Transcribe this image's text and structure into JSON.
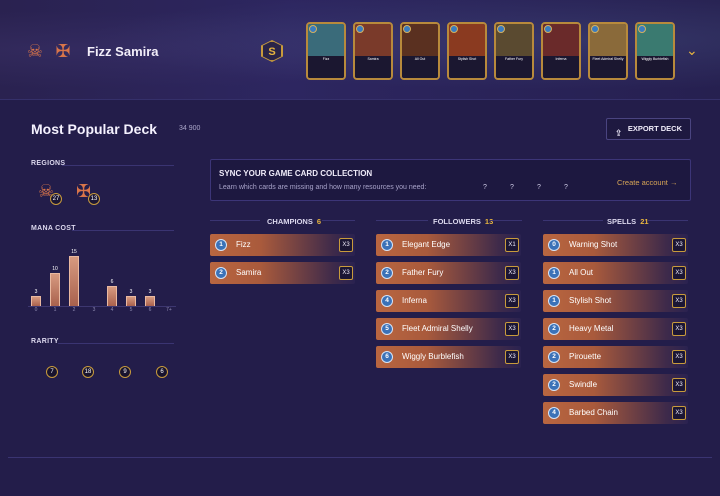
{
  "header": {
    "deck_title": "Fizz Samira",
    "tier": "S",
    "region_icons": [
      "bilgewater-icon",
      "noxus-icon"
    ],
    "cards": [
      {
        "name": "Fizz",
        "color": "#3a6b7a"
      },
      {
        "name": "Samira",
        "color": "#7a3a2a"
      },
      {
        "name": "All Out",
        "color": "#5a3020"
      },
      {
        "name": "Stylish Shot",
        "color": "#8a3a20"
      },
      {
        "name": "Father Fury",
        "color": "#5a4a30"
      },
      {
        "name": "Inferna",
        "color": "#6a2a2a"
      },
      {
        "name": "Fleet Admiral Shelly",
        "color": "#8a6a3a"
      },
      {
        "name": "Wiggly Burblefish",
        "color": "#3a7a70"
      }
    ]
  },
  "deck": {
    "title": "Most Popular Deck",
    "count": "34 900",
    "export_label": "EXPORT DECK"
  },
  "regions": {
    "label": "REGIONS",
    "items": [
      {
        "icon": "bilgewater-icon",
        "count": "27"
      },
      {
        "icon": "noxus-icon",
        "count": "13"
      }
    ]
  },
  "mana_cost": {
    "label": "MANA COST",
    "chart_data": {
      "type": "bar",
      "categories": [
        "0",
        "1",
        "2",
        "3",
        "4",
        "5",
        "6",
        "7+"
      ],
      "values": [
        3,
        10,
        15,
        0,
        6,
        3,
        3,
        0
      ]
    }
  },
  "rarity": {
    "label": "RARITY",
    "values": [
      "7",
      "18",
      "9",
      "6"
    ]
  },
  "sync": {
    "title": "SYNC YOUR GAME CARD COLLECTION",
    "subtitle": "Learn which cards are missing and how many resources you need:",
    "unknowns": [
      "?",
      "?",
      "?",
      "?"
    ],
    "link": "Create account →"
  },
  "columns": {
    "champions": {
      "label": "CHAMPIONS",
      "count": "6",
      "cards": [
        {
          "mana": "1",
          "name": "Fizz",
          "qty": "X3"
        },
        {
          "mana": "2",
          "name": "Samira",
          "qty": "X3"
        }
      ]
    },
    "followers": {
      "label": "FOLLOWERS",
      "count": "13",
      "cards": [
        {
          "mana": "1",
          "name": "Elegant Edge",
          "qty": "X1"
        },
        {
          "mana": "2",
          "name": "Father Fury",
          "qty": "X3"
        },
        {
          "mana": "4",
          "name": "Inferna",
          "qty": "X3"
        },
        {
          "mana": "5",
          "name": "Fleet Admiral Shelly",
          "qty": "X3"
        },
        {
          "mana": "6",
          "name": "Wiggly Burblefish",
          "qty": "X3"
        }
      ]
    },
    "spells": {
      "label": "SPELLS",
      "count": "21",
      "cards": [
        {
          "mana": "0",
          "name": "Warning Shot",
          "qty": "X3"
        },
        {
          "mana": "1",
          "name": "All Out",
          "qty": "X3"
        },
        {
          "mana": "1",
          "name": "Stylish Shot",
          "qty": "X3"
        },
        {
          "mana": "2",
          "name": "Heavy Metal",
          "qty": "X3"
        },
        {
          "mana": "2",
          "name": "Pirouette",
          "qty": "X3"
        },
        {
          "mana": "2",
          "name": "Swindle",
          "qty": "X3"
        },
        {
          "mana": "4",
          "name": "Barbed Chain",
          "qty": "X3"
        }
      ]
    }
  }
}
